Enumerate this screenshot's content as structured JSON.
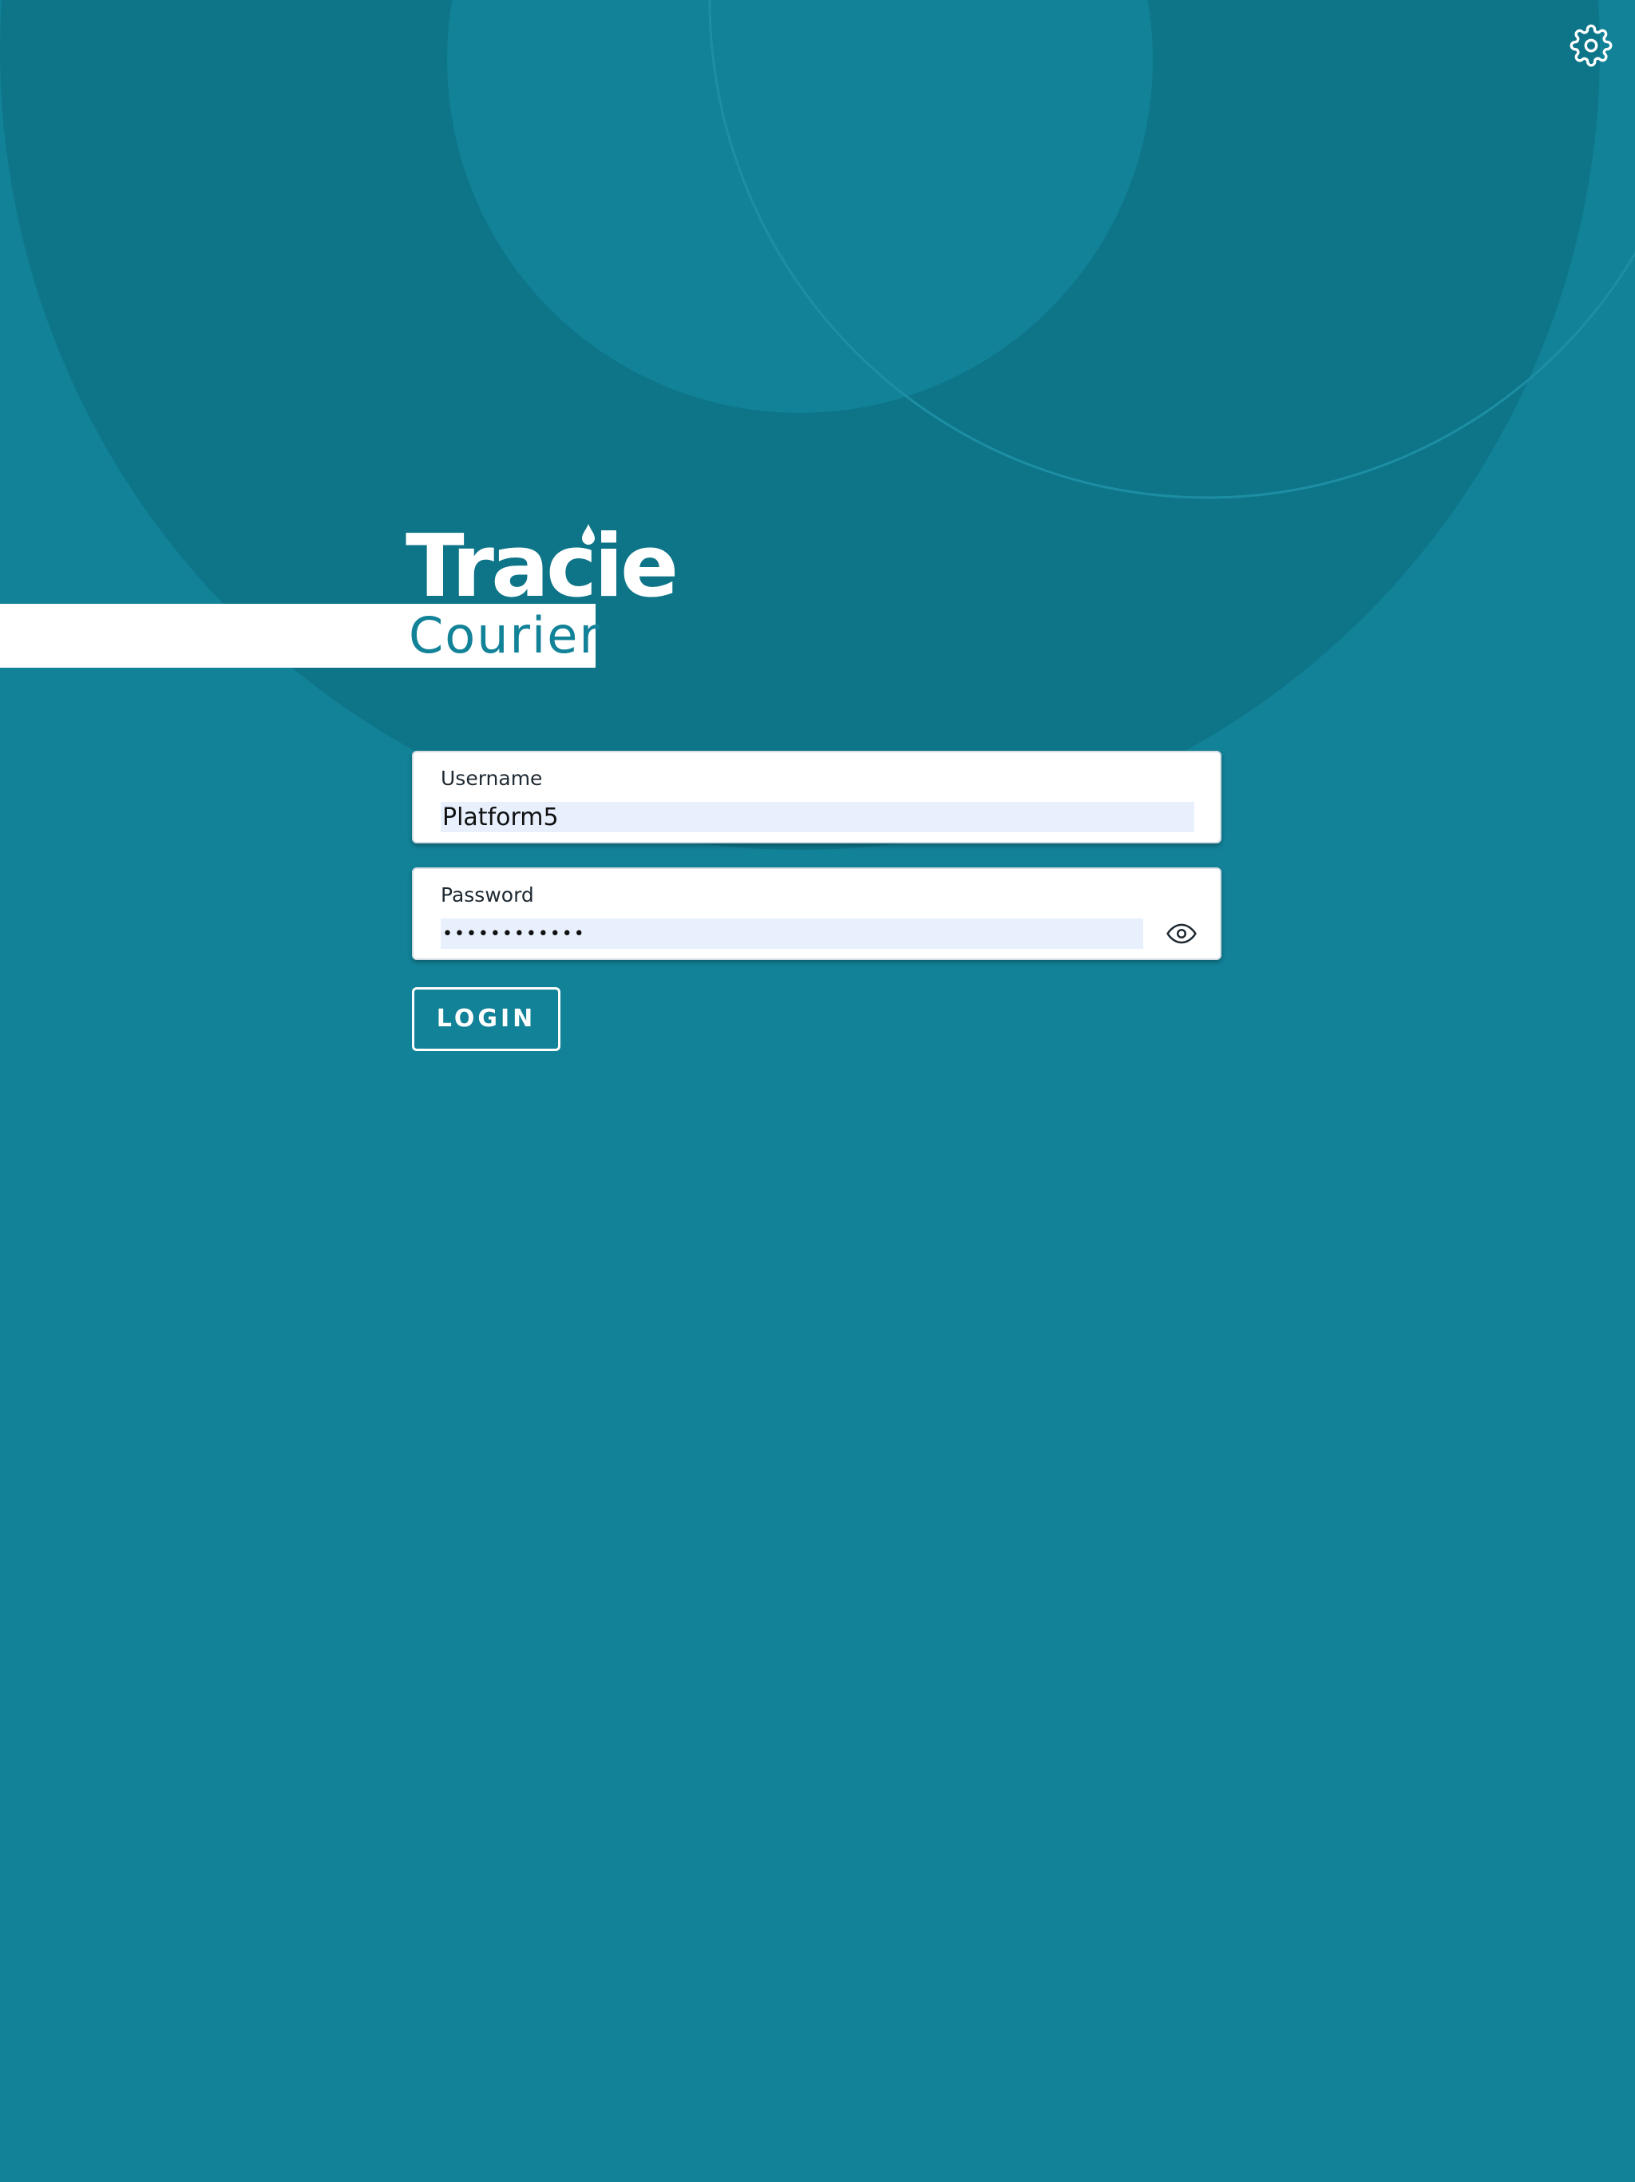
{
  "app": {
    "logo_title": "Tracie",
    "logo_subtitle": "Courier"
  },
  "login_form": {
    "username": {
      "label": "Username",
      "value": "Platform5"
    },
    "password": {
      "label": "Password",
      "value": "••••••••••••"
    },
    "login_label": "LOGIN"
  },
  "icons": {
    "settings": "gear-icon",
    "password_visibility": "eye-icon",
    "logo_mark": "drop-icon"
  },
  "colors": {
    "background": "#128298",
    "background_dark": "#0e7589",
    "accent_text": "#128298",
    "input_fill": "#e8f0fe",
    "button_border": "#ffffff"
  }
}
